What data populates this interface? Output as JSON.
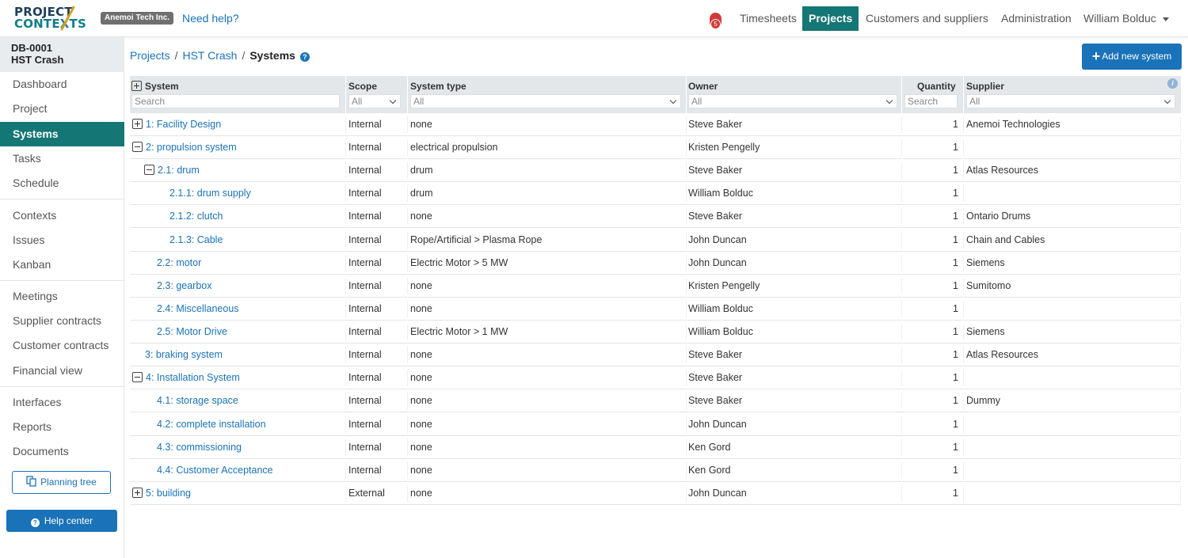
{
  "header": {
    "logo_line1": "PROJECT",
    "logo_line2": "CONTEXTS",
    "company": "Anemoi Tech Inc.",
    "need_help": "Need help?",
    "notifications": "5",
    "nav": [
      "Timesheets",
      "Projects",
      "Customers and suppliers",
      "Administration"
    ],
    "active_nav": "Projects",
    "user": "William Bolduc"
  },
  "sidebar": {
    "project_id": "DB-0001",
    "project_name": "HST Crash",
    "groups": [
      [
        "Dashboard",
        "Project",
        "Systems",
        "Tasks",
        "Schedule"
      ],
      [
        "Contexts",
        "Issues",
        "Kanban"
      ],
      [
        "Meetings",
        "Supplier contracts",
        "Customer contracts",
        "Financial view"
      ],
      [
        "Interfaces",
        "Reports",
        "Documents"
      ]
    ],
    "active": "Systems",
    "planning_tree": "Planning tree",
    "help_center": "Help center"
  },
  "breadcrumb": {
    "items": [
      "Projects",
      "HST Crash"
    ],
    "current": "Systems"
  },
  "add_button": "Add new system",
  "table": {
    "columns": {
      "system": "System",
      "scope": "Scope",
      "system_type": "System type",
      "owner": "Owner",
      "quantity": "Quantity",
      "supplier": "Supplier"
    },
    "filters": {
      "system": "Search",
      "scope": "All",
      "system_type": "All",
      "owner": "All",
      "quantity": "Search",
      "supplier": "All"
    },
    "rows": [
      {
        "level": 0,
        "toggle": "plus",
        "system": "1: Facility Design",
        "scope": "Internal",
        "type": "none",
        "owner": "Steve Baker",
        "qty": "1",
        "supplier": "Anemoi Technologies"
      },
      {
        "level": 0,
        "toggle": "minus",
        "system": "2: propulsion system",
        "scope": "Internal",
        "type": "electrical propulsion",
        "owner": "Kristen Pengelly",
        "qty": "1",
        "supplier": ""
      },
      {
        "level": 1,
        "toggle": "minus",
        "system": "2.1: drum",
        "scope": "Internal",
        "type": "drum",
        "owner": "Steve Baker",
        "qty": "1",
        "supplier": "Atlas Resources"
      },
      {
        "level": 2,
        "toggle": "",
        "system": "2.1.1: drum supply",
        "scope": "Internal",
        "type": "drum",
        "owner": "William Bolduc",
        "qty": "1",
        "supplier": ""
      },
      {
        "level": 2,
        "toggle": "",
        "system": "2.1.2: clutch",
        "scope": "Internal",
        "type": "none",
        "owner": "Steve Baker",
        "qty": "1",
        "supplier": "Ontario Drums"
      },
      {
        "level": 2,
        "toggle": "",
        "system": "2.1.3: Cable",
        "scope": "Internal",
        "type": "Rope/Artificial > Plasma Rope",
        "owner": "John Duncan",
        "qty": "1",
        "supplier": "Chain and Cables"
      },
      {
        "level": 1,
        "toggle": "",
        "system": "2.2: motor",
        "scope": "Internal",
        "type": "Electric Motor > 5 MW",
        "owner": "John Duncan",
        "qty": "1",
        "supplier": "Siemens"
      },
      {
        "level": 1,
        "toggle": "",
        "system": "2.3: gearbox",
        "scope": "Internal",
        "type": "none",
        "owner": "Kristen Pengelly",
        "qty": "1",
        "supplier": "Sumitomo"
      },
      {
        "level": 1,
        "toggle": "",
        "system": "2.4: Miscellaneous",
        "scope": "Internal",
        "type": "none",
        "owner": "William Bolduc",
        "qty": "1",
        "supplier": ""
      },
      {
        "level": 1,
        "toggle": "",
        "system": "2.5: Motor Drive",
        "scope": "Internal",
        "type": "Electric Motor > 1 MW",
        "owner": "William Bolduc",
        "qty": "1",
        "supplier": "Siemens"
      },
      {
        "level": 0,
        "toggle": "",
        "system": "3: braking system",
        "scope": "Internal",
        "type": "none",
        "owner": "Steve Baker",
        "qty": "1",
        "supplier": "Atlas Resources"
      },
      {
        "level": 0,
        "toggle": "minus",
        "system": "4: Installation System",
        "scope": "Internal",
        "type": "none",
        "owner": "Steve Baker",
        "qty": "1",
        "supplier": ""
      },
      {
        "level": 1,
        "toggle": "",
        "system": "4.1: storage space",
        "scope": "Internal",
        "type": "none",
        "owner": "Steve Baker",
        "qty": "1",
        "supplier": "Dummy"
      },
      {
        "level": 1,
        "toggle": "",
        "system": "4.2: complete installation",
        "scope": "Internal",
        "type": "none",
        "owner": "John Duncan",
        "qty": "1",
        "supplier": ""
      },
      {
        "level": 1,
        "toggle": "",
        "system": "4.3: commissioning",
        "scope": "Internal",
        "type": "none",
        "owner": "Ken Gord",
        "qty": "1",
        "supplier": ""
      },
      {
        "level": 1,
        "toggle": "",
        "system": "4.4: Customer Acceptance",
        "scope": "Internal",
        "type": "none",
        "owner": "Ken Gord",
        "qty": "1",
        "supplier": ""
      },
      {
        "level": 0,
        "toggle": "plus",
        "system": "5: building",
        "scope": "External",
        "type": "none",
        "owner": "John Duncan",
        "qty": "1",
        "supplier": ""
      }
    ]
  },
  "colors": {
    "accent": "#147675",
    "link": "#1a72b8",
    "header_bg": "#e4e7ea"
  }
}
